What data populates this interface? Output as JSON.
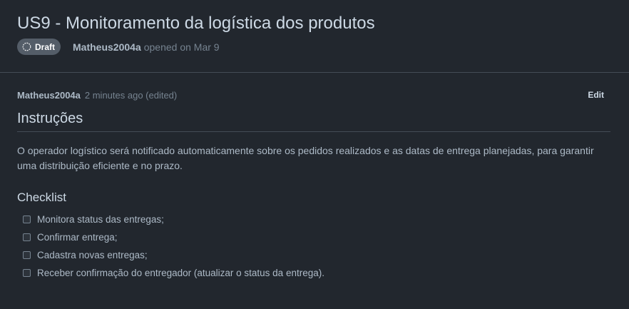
{
  "issue": {
    "title": "US9 - Monitoramento da logística dos produtos",
    "status_badge": "Draft",
    "author": "Matheus2004a",
    "opened_text": "opened on Mar 9"
  },
  "comment": {
    "author": "Matheus2004a",
    "time_text": "2 minutes ago (edited)",
    "edit_label": "Edit",
    "section_heading": "Instruções",
    "description": "O operador logístico será notificado automaticamente sobre os pedidos realizados e as datas de entrega planejadas, para garantir uma distribuição eficiente e no prazo.",
    "checklist_heading": "Checklist",
    "checklist": [
      {
        "label": "Monitora status das entregas;",
        "checked": false
      },
      {
        "label": "Confirmar entrega;",
        "checked": false
      },
      {
        "label": "Cadastra novas entregas;",
        "checked": false
      },
      {
        "label": "Receber confirmação do entregador (atualizar o status da entrega).",
        "checked": false
      }
    ]
  },
  "colors": {
    "background": "#22272e",
    "badge_background": "#545d68",
    "border": "#444c56",
    "text_primary": "#cdd9e5",
    "text_secondary": "#768390"
  },
  "icons": {
    "draft": "draft-dashed-circle-icon"
  }
}
